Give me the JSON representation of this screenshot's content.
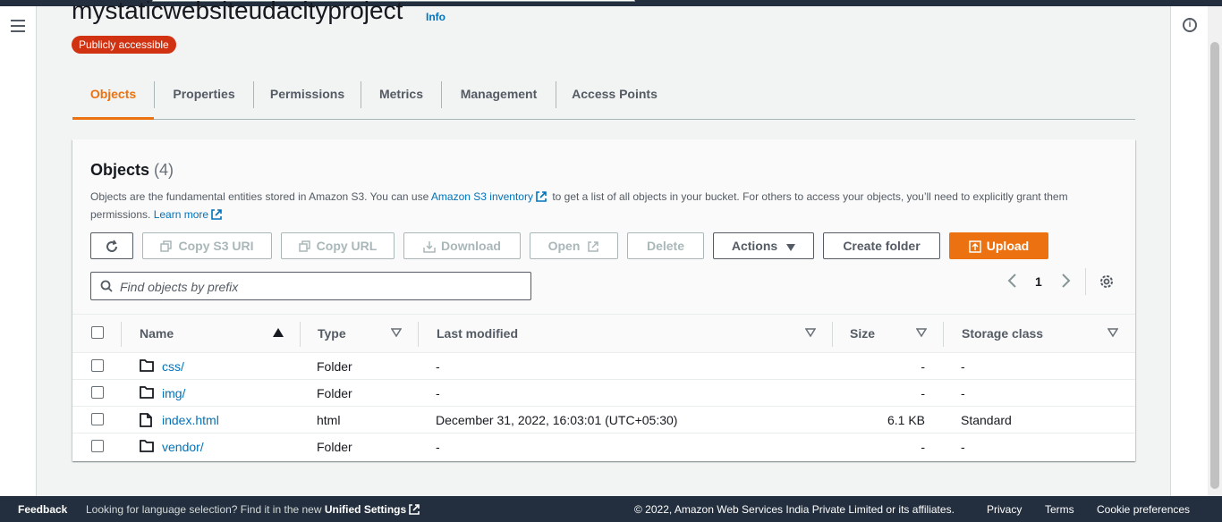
{
  "header": {
    "bucket_name": "mystaticwebsiteudacityproject",
    "info_label": "Info",
    "access_badge": "Publicly accessible"
  },
  "tabs": [
    {
      "label": "Objects",
      "active": true
    },
    {
      "label": "Properties"
    },
    {
      "label": "Permissions"
    },
    {
      "label": "Metrics"
    },
    {
      "label": "Management"
    },
    {
      "label": "Access Points"
    }
  ],
  "objects_panel": {
    "title": "Objects",
    "count": "(4)",
    "description_pre": "Objects are the fundamental entities stored in Amazon S3. You can use ",
    "inventory_link": "Amazon S3 inventory",
    "description_mid": " to get a list of all objects in your bucket. For others to access your objects, you’ll need to explicitly grant them permissions. ",
    "learn_more": "Learn more"
  },
  "toolbar": {
    "copy_s3_uri": "Copy S3 URI",
    "copy_url": "Copy URL",
    "download": "Download",
    "open": "Open",
    "delete": "Delete",
    "actions": "Actions",
    "create_folder": "Create folder",
    "upload": "Upload"
  },
  "search": {
    "placeholder": "Find objects by prefix"
  },
  "pagination": {
    "page": "1"
  },
  "table": {
    "columns": {
      "name": "Name",
      "type": "Type",
      "last_modified": "Last modified",
      "size": "Size",
      "storage_class": "Storage class"
    },
    "rows": [
      {
        "name": "css/",
        "type": "Folder",
        "last_modified": "-",
        "size": "-",
        "storage_class": "-",
        "kind": "folder"
      },
      {
        "name": "img/",
        "type": "Folder",
        "last_modified": "-",
        "size": "-",
        "storage_class": "-",
        "kind": "folder"
      },
      {
        "name": "index.html",
        "type": "html",
        "last_modified": "December 31, 2022, 16:03:01 (UTC+05:30)",
        "size": "6.1 KB",
        "storage_class": "Standard",
        "kind": "file"
      },
      {
        "name": "vendor/",
        "type": "Folder",
        "last_modified": "-",
        "size": "-",
        "storage_class": "-",
        "kind": "folder"
      }
    ]
  },
  "footer": {
    "feedback": "Feedback",
    "language_text": "Looking for language selection? Find it in the new ",
    "unified_settings": "Unified Settings",
    "copyright": "© 2022, Amazon Web Services India Private Limited or its affiliates.",
    "privacy": "Privacy",
    "terms": "Terms",
    "cookie_preferences": "Cookie preferences"
  },
  "colors": {
    "accent": "#ec7211",
    "link": "#0073bb",
    "badge": "#d13212",
    "nav": "#232f3e"
  }
}
